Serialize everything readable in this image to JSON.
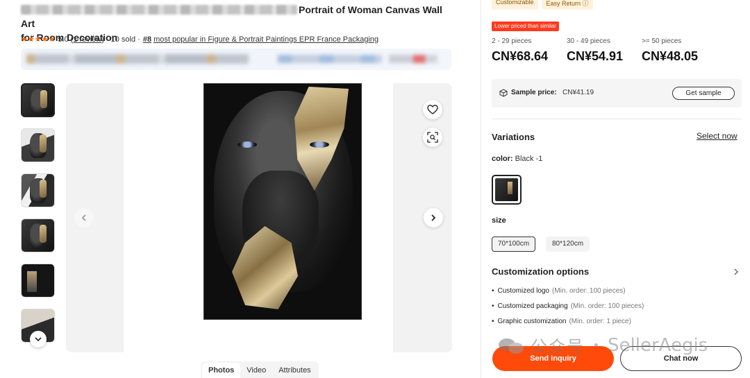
{
  "product": {
    "title_visible": "Portrait of Woman Canvas Wall Art",
    "title_line2": "for Room Decoration",
    "stars": "★★★★★",
    "rating": "5.0",
    "reviews": "(1 review)",
    "sold": "· 10 sold ·",
    "rank": "#8",
    "rank_text": "most popular in Figure & Portrait Paintings EPR France Packaging"
  },
  "gallery": {
    "tabs": [
      "Photos",
      "Video",
      "Attributes"
    ],
    "active_tab": "Photos"
  },
  "badges": [
    "Customizable",
    "Easy Return ⓘ"
  ],
  "lower_price_tag": "Lower priced than similar",
  "price_tiers": [
    {
      "qty": "2 - 29 pieces",
      "price": "CN¥68.64"
    },
    {
      "qty": "30 - 49 pieces",
      "price": "CN¥54.91"
    },
    {
      "qty": ">= 50 pieces",
      "price": "CN¥48.05"
    }
  ],
  "sample": {
    "label": "Sample price:",
    "value": "CN¥41.19",
    "button": "Get sample"
  },
  "variations": {
    "title": "Variations",
    "select_now": "Select now",
    "color_label": "color:",
    "color_value": "Black -1",
    "size_label": "size",
    "sizes": [
      "70*100cm",
      "80*120cm"
    ],
    "selected_size": "70*100cm"
  },
  "customization": {
    "title": "Customization options",
    "items": [
      {
        "name": "Customized logo",
        "min": "(Min. order: 100 pieces)"
      },
      {
        "name": "Customized packaging",
        "min": "(Min. order: 100 pieces)"
      },
      {
        "name": "Graphic customization",
        "min": "(Min. order: 1 piece)"
      }
    ]
  },
  "actions": {
    "send_inquiry": "Send inquiry",
    "chat_now": "Chat now"
  },
  "watermark": {
    "cn": "公众号",
    "en": "SellerAegis"
  },
  "colors": {
    "accent": "#ff4a0a",
    "badge_red": "#ff3b1f",
    "star": "#ff6a00"
  }
}
